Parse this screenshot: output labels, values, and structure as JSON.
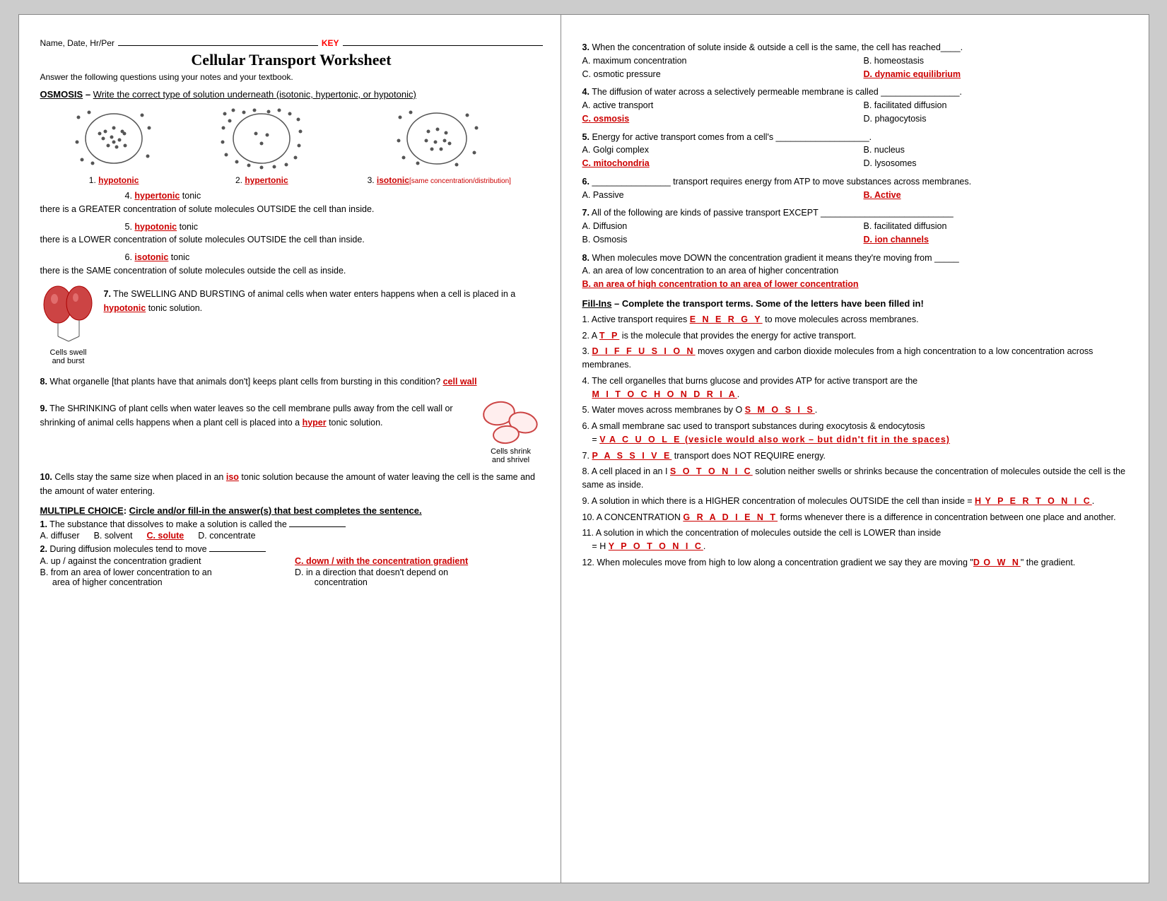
{
  "header": {
    "name_label": "Name, Date, Hr/Per",
    "key_text": "KEY",
    "title": "Cellular Transport Worksheet",
    "subtitle": "Answer the following questions using your notes and your textbook."
  },
  "osmosis": {
    "section_label": "OSMOSIS",
    "dash": "–",
    "instruction": "Write the correct type of solution underneath (isotonic, hypertonic, or hypotonic)",
    "diagrams": [
      {
        "num": "1.",
        "answer": "hypotonic"
      },
      {
        "num": "2.",
        "answer": "hypertonic"
      },
      {
        "num": "3.",
        "answer": "isotonic",
        "extra": "[same concentration/distribution]"
      }
    ],
    "q4_num": "4.",
    "q4_blank": "hypertonic",
    "q4_text": "tonic\nthere is a GREATER concentration of solute molecules OUTSIDE the cell than inside.",
    "q5_num": "5.",
    "q5_blank": "hypotonic",
    "q5_text": "tonic\nthere is a LOWER concentration of solute molecules OUTSIDE the cell than inside.",
    "q6_num": "6.",
    "q6_blank": "isotonic",
    "q6_text": "tonic\nthere is the SAME concentration of solute molecules outside the cell as inside."
  },
  "questions_left": [
    {
      "num": "7.",
      "text": "The SWELLING AND BURSTING of animal cells when water enters happens when a cell is placed in a",
      "blank": "hypotonic",
      "text2": "tonic solution.",
      "img_label": "Cells swell\nand burst"
    },
    {
      "num": "8.",
      "text": "What organelle [that plants have that animals don't] keeps plant cells from bursting in this condition?",
      "blank": "cell wall",
      "img_label": "Cells shrink\nand shrivel"
    },
    {
      "num": "9.",
      "text": "The SHRINKING of plant cells when water leaves so the cell membrane pulls away from the cell wall or shrinking of animal cells happens when a plant cell is placed into a",
      "blank": "hyper",
      "text2": "tonic solution."
    },
    {
      "num": "10.",
      "text": "Cells stay the same size when placed in an",
      "blank": "iso",
      "text2": "tonic solution because the amount of water leaving the cell is the same and the amount of water entering."
    }
  ],
  "mc": {
    "header": "MULTIPLE CHOICE",
    "instruction": "Circle and/or fill-in the answer(s) that best completes the sentence.",
    "questions": [
      {
        "num": "1.",
        "text": "The substance that dissolves to make a solution is called the",
        "blank": "",
        "options": [
          {
            "label": "A. diffuser",
            "correct": false
          },
          {
            "label": "B. solvent",
            "correct": false
          },
          {
            "label": "C. solute",
            "correct": true
          },
          {
            "label": "D. concentrate",
            "correct": false
          }
        ]
      },
      {
        "num": "2.",
        "text": "During diffusion molecules tend to move",
        "blank": "",
        "options": [
          {
            "label": "A.  up / against the concentration gradient",
            "correct": false
          },
          {
            "label": "C. down / with the concentration gradient",
            "correct": true
          },
          {
            "label": "B.  from an area of lower concentration to an area of higher concentration",
            "correct": false
          },
          {
            "label": "D.  in a direction that doesn't depend on concentration",
            "correct": false
          }
        ]
      }
    ]
  },
  "right": {
    "questions": [
      {
        "num": "3.",
        "text": "When the concentration of solute inside & outside a cell is the same, the cell has reached____.",
        "options": [
          {
            "label": "A. maximum concentration",
            "correct": false
          },
          {
            "label": "B. homeostasis",
            "correct": false
          },
          {
            "label": "C. osmotic pressure",
            "correct": false
          },
          {
            "label": "D. dynamic equilibrium",
            "correct": true
          }
        ]
      },
      {
        "num": "4.",
        "text": "The diffusion of water across a selectively permeable membrane is called ________________.",
        "options": [
          {
            "label": "A. active transport",
            "correct": false
          },
          {
            "label": "B. facilitated diffusion",
            "correct": false
          },
          {
            "label": "C. osmosis",
            "correct": true
          },
          {
            "label": "D. phagocytosis",
            "correct": false
          }
        ]
      },
      {
        "num": "5.",
        "text": "Energy for active transport comes from a cell's ___________________.",
        "options": [
          {
            "label": "A. Golgi complex",
            "correct": false
          },
          {
            "label": "B. nucleus",
            "correct": false
          },
          {
            "label": "C. mitochondria",
            "correct": true
          },
          {
            "label": "D. lysosomes",
            "correct": false
          }
        ]
      },
      {
        "num": "6.",
        "text": "________________ transport requires energy from ATP to move substances across membranes.",
        "options": [
          {
            "label": "A. Passive",
            "correct": false
          },
          {
            "label": "B. Active",
            "correct": true
          }
        ]
      },
      {
        "num": "7.",
        "text": "All of the following are kinds of passive transport EXCEPT ___________________________",
        "options": [
          {
            "label": "A.  Diffusion",
            "correct": false
          },
          {
            "label": "B.  facilitated diffusion",
            "correct": false
          },
          {
            "label": "B.  Osmosis",
            "correct": false
          },
          {
            "label": "D. ion channels",
            "correct": true
          }
        ]
      },
      {
        "num": "8.",
        "text": "When molecules move DOWN the concentration gradient it means they're moving from _____",
        "options": [
          {
            "label": "A.  an area of low concentration to an area of higher concentration",
            "correct": false
          },
          {
            "label": "B. an area of high concentration to an area of lower concentration",
            "correct": true
          }
        ]
      }
    ],
    "fill_ins": {
      "header": "Fill-Ins",
      "instruction": "– Complete the transport terms. Some of the letters have been filled in!",
      "items": [
        {
          "num": "1.",
          "text": "Active transport requires ",
          "answer": "E N E R G Y",
          "text2": " to move molecules across membranes."
        },
        {
          "num": "2.",
          "text": "A ",
          "answer": "T P",
          "prefix": "A ",
          "text2": " is the molecule that provides the energy for active transport."
        },
        {
          "num": "3.",
          "text": "D ",
          "answer": "I F F U S I O N",
          "prefix": "D",
          "text2": " moves oxygen and carbon dioxide molecules from a high concentration to a low concentration across membranes."
        },
        {
          "num": "4.",
          "text": "The cell organelles that burns glucose and provides ATP for active transport are the ",
          "answer": "M I T O C H O N D R I A",
          "text2": "."
        },
        {
          "num": "5.",
          "text": "Water moves across membranes by O ",
          "answer": "S M O S I S",
          "prefix": "O",
          "text2": "."
        },
        {
          "num": "6.",
          "text": "A small membrane sac used to transport substances during exocytosis & endocytosis\n= V ",
          "answer": "A C U O L E (vesicle would also work – but didn't fit in the spaces)",
          "prefix": "V"
        },
        {
          "num": "7.",
          "text": "P ",
          "answer": "A S S I V E",
          "prefix": "P",
          "text2": " transport does NOT REQUIRE energy."
        },
        {
          "num": "8.",
          "text": "A cell placed in an I ",
          "answer": "S O T O N I C",
          "prefix": "I",
          "text2": " solution neither swells or shrinks because the concentration of molecules outside the cell is the same as inside."
        },
        {
          "num": "9.",
          "text": "A solution in which there is a HIGHER concentration of molecules OUTSIDE the cell than inside = H ",
          "answer": "Y P E R T O N I C",
          "prefix": "H",
          "text2": "."
        },
        {
          "num": "10.",
          "text": "A CONCENTRATION G ",
          "answer": "R A D I E N T",
          "prefix": "G",
          "text2": " forms whenever there is a difference in concentration between one place and another."
        },
        {
          "num": "11.",
          "text": "A solution in which the concentration of molecules outside the cell is LOWER than inside = H ",
          "answer": "Y P O T O N I C",
          "prefix": "H",
          "text2": "."
        },
        {
          "num": "12.",
          "text": "When molecules move from high to low along a concentration gradient we say they are moving \"D ",
          "answer": "O W N",
          "prefix": "D",
          "text2": "\" the gradient."
        }
      ]
    }
  }
}
